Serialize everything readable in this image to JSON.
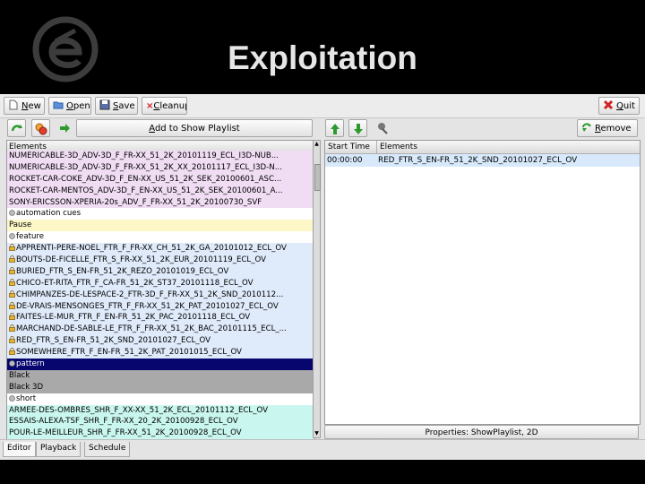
{
  "slide": {
    "title": "Exploitation"
  },
  "toolbar": {
    "new": {
      "u": "N",
      "rest": "ew"
    },
    "open": {
      "u": "O",
      "rest": "pen"
    },
    "save": {
      "u": "S",
      "rest": "ave"
    },
    "cleanup": {
      "u": "C",
      "rest": "leanup"
    },
    "quit": {
      "u": "Q",
      "rest": "uit"
    }
  },
  "left_pane": {
    "add_button": {
      "u": "A",
      "rest": "dd to Show Playlist"
    },
    "header": "Elements",
    "rows": [
      {
        "text": "NUMERICABLE-3D_ADV-3D_F_FR-XX_51_2K_20101119_ECL_I3D-NUB...",
        "bg": "#f0dcf3",
        "icon": ""
      },
      {
        "text": "NUMERICABLE-3D_ADV-3D_F_FR-XX_51_2K_XX_20101117_ECL_I3D-N...",
        "bg": "#f0dcf3",
        "icon": ""
      },
      {
        "text": "ROCKET-CAR-COKE_ADV-3D_F_EN-XX_US_51_2K_SEK_20100601_ASC...",
        "bg": "#f0dcf3",
        "icon": ""
      },
      {
        "text": "ROCKET-CAR-MENTOS_ADV-3D_F_EN-XX_US_51_2K_SEK_20100601_A...",
        "bg": "#f0dcf3",
        "icon": ""
      },
      {
        "text": "SONY-ERICSSON-XPERIA-20s_ADV_F_FR-XX_51_2K_20100730_SVF",
        "bg": "#f0dcf3",
        "icon": ""
      },
      {
        "text": "automation cues",
        "bg": "#ffffff",
        "icon": "dot"
      },
      {
        "text": "Pause",
        "bg": "#fdf7c8",
        "icon": ""
      },
      {
        "text": "feature",
        "bg": "#ffffff",
        "icon": "dot"
      },
      {
        "text": "APPRENTI-PERE-NOEL_FTR_F_FR-XX_CH_51_2K_GA_20101012_ECL_OV",
        "bg": "#dfeafa",
        "icon": "lock"
      },
      {
        "text": "BOUTS-DE-FICELLE_FTR_S_FR-XX_51_2K_EUR_20101119_ECL_OV",
        "bg": "#dfeafa",
        "icon": "lock"
      },
      {
        "text": "BURIED_FTR_S_EN-FR_51_2K_REZO_20101019_ECL_OV",
        "bg": "#dfeafa",
        "icon": "lock"
      },
      {
        "text": "CHICO-ET-RITA_FTR_F_CA-FR_51_2K_ST37_20101118_ECL_OV",
        "bg": "#dfeafa",
        "icon": "lock"
      },
      {
        "text": "CHIMPANZES-DE-LESPACE-2_FTR-3D_F_FR-XX_51_2K_SND_2010112...",
        "bg": "#dfeafa",
        "icon": "lock"
      },
      {
        "text": "DE-VRAIS-MENSONGES_FTR_F_FR-XX_51_2K_PAT_20101027_ECL_OV",
        "bg": "#dfeafa",
        "icon": "lock"
      },
      {
        "text": "FAITES-LE-MUR_FTR_F_EN-FR_51_2K_PAC_20101118_ECL_OV",
        "bg": "#dfeafa",
        "icon": "lock"
      },
      {
        "text": "MARCHAND-DE-SABLE-LE_FTR_F_FR-XX_51_2K_BAC_20101115_ECL_...",
        "bg": "#dfeafa",
        "icon": "lock"
      },
      {
        "text": "RED_FTR_S_EN-FR_51_2K_SND_20101027_ECL_OV",
        "bg": "#dfeafa",
        "icon": "lock"
      },
      {
        "text": "SOMEWHERE_FTR_F_EN-FR_51_2K_PAT_20101015_ECL_OV",
        "bg": "#dfeafa",
        "icon": "lock"
      },
      {
        "text": "pattern",
        "bg": "#06066e",
        "icon": "dot",
        "color": "#ffffff"
      },
      {
        "text": "Black",
        "bg": "#a9a9a9",
        "icon": ""
      },
      {
        "text": "Black 3D",
        "bg": "#a9a9a9",
        "icon": ""
      },
      {
        "text": "short",
        "bg": "#ffffff",
        "icon": "dot"
      },
      {
        "text": "ARMEE-DES-OMBRES_SHR_F_XX-XX_51_2K_ECL_20101112_ECL_OV",
        "bg": "#c9f6ee",
        "icon": ""
      },
      {
        "text": "ESSAIS-ALEXA-TSF_SHR_F_FR-XX_20_2K_20100928_ECL_OV",
        "bg": "#c9f6ee",
        "icon": ""
      },
      {
        "text": "POUR-LE-MEILLEUR_SHR_F_FR-XX_51_2K_20100928_ECL_OV",
        "bg": "#c9f6ee",
        "icon": ""
      }
    ]
  },
  "right_pane": {
    "remove_button": {
      "u": "R",
      "rest": "emove"
    },
    "headers": [
      "Start Time",
      "Elements"
    ],
    "rows": [
      {
        "time": "00:00:00",
        "element": "RED_FTR_S_EN-FR_51_2K_SND_20101027_ECL_OV"
      }
    ],
    "properties": "Properties: ShowPlaylist, 2D"
  },
  "tabs": [
    "Editor",
    "Playback",
    "Schedule"
  ],
  "colors": {
    "accent_green": "#2e9a2e",
    "quit_red": "#d42020",
    "selection": "#06066e"
  }
}
